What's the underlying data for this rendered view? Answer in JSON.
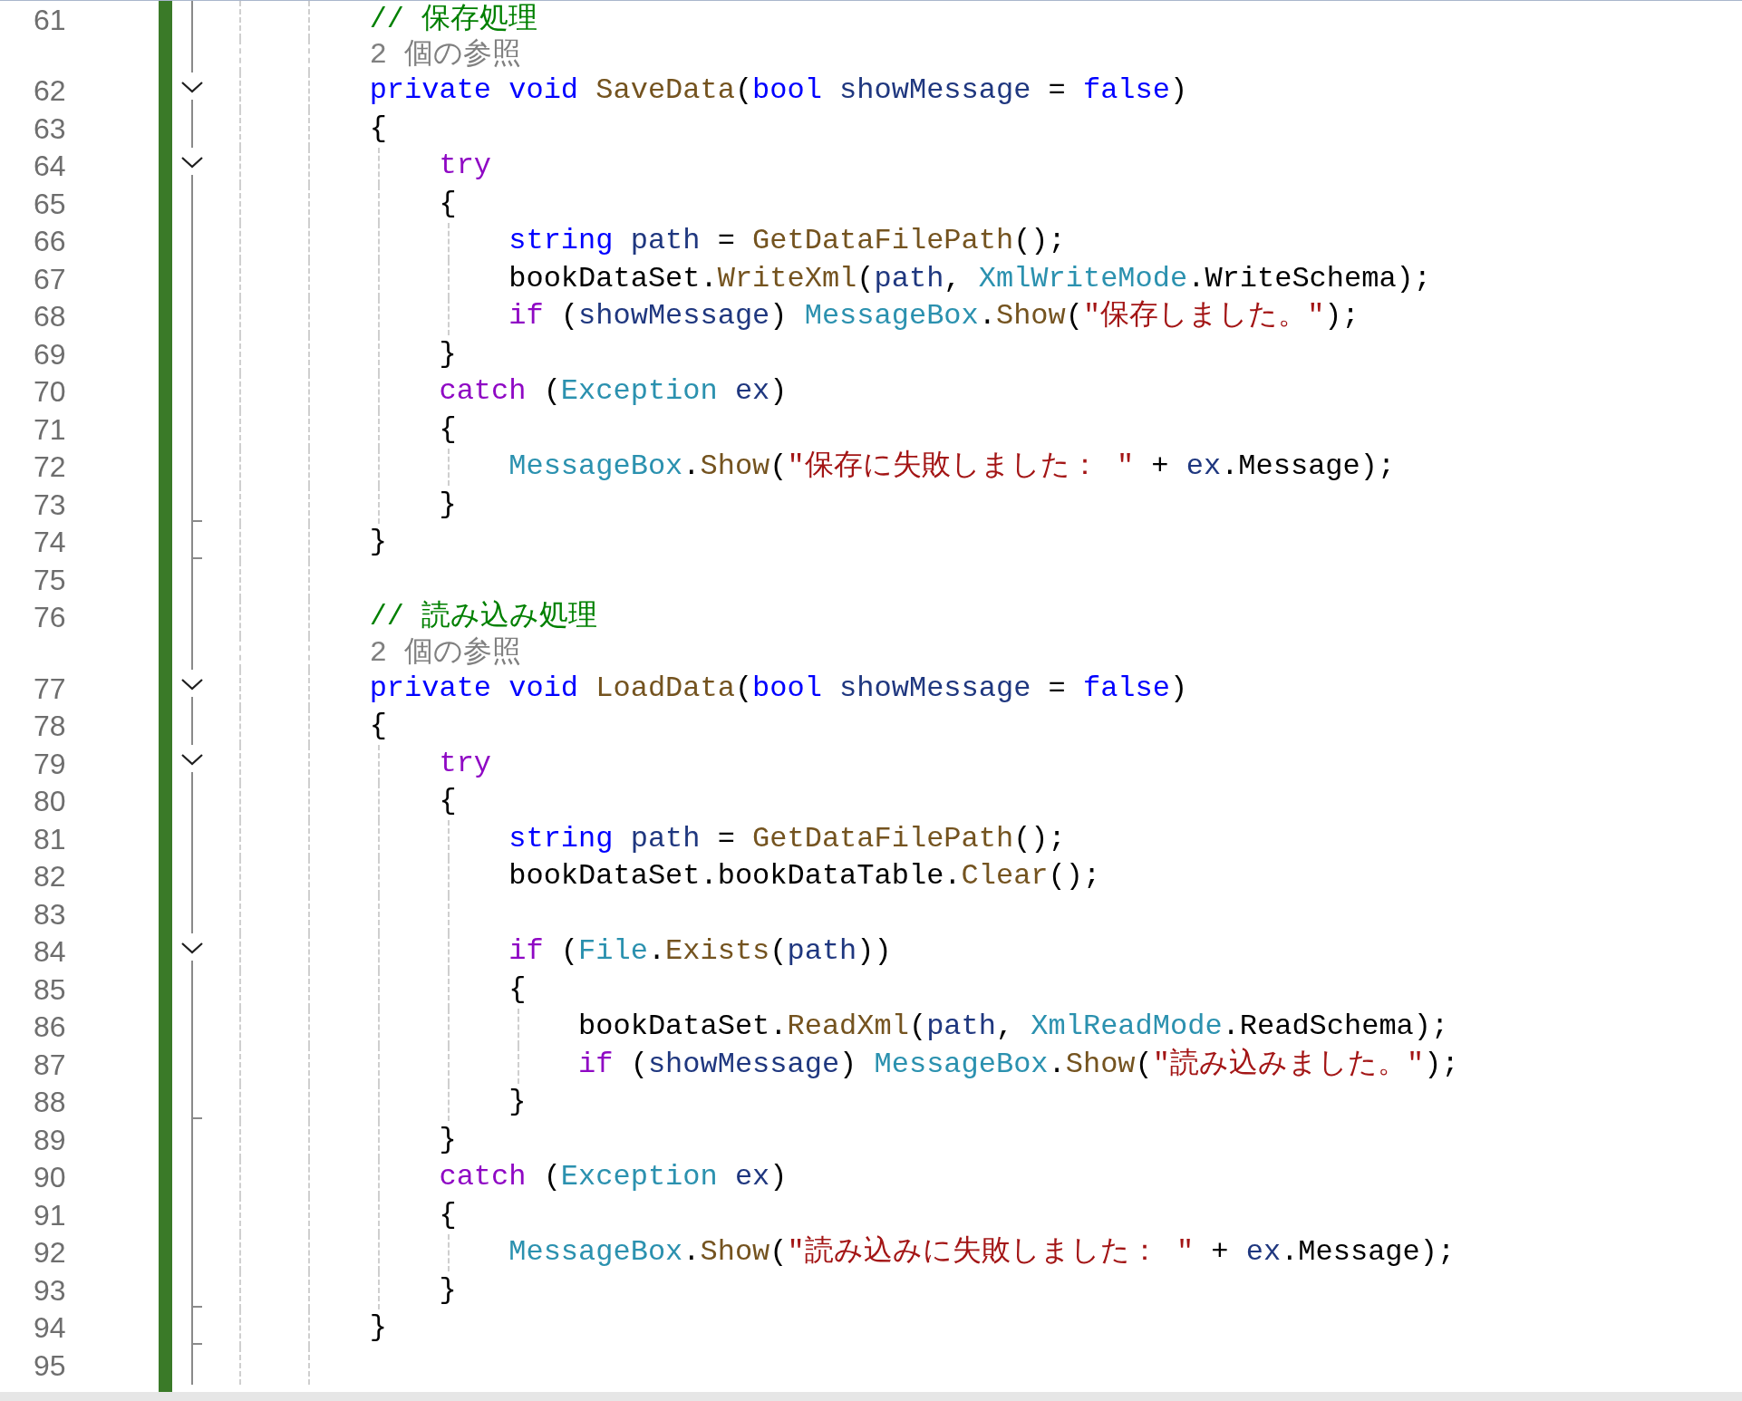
{
  "editor": {
    "lines": [
      {
        "kind": "code",
        "number": "61",
        "foldable": false,
        "block_end": false,
        "tokens": [
          {
            "kind": "comment",
            "text": "        // 保存処理"
          }
        ]
      },
      {
        "kind": "codelens",
        "foldable": false,
        "block_end": false,
        "tokens": [
          {
            "kind": "lens",
            "text": "        2 個の参照"
          }
        ]
      },
      {
        "kind": "code",
        "number": "62",
        "foldable": true,
        "block_end": false,
        "tokens": [
          {
            "kind": "keyword",
            "text": "        private "
          },
          {
            "kind": "keyword",
            "text": "void "
          },
          {
            "kind": "method",
            "text": "SaveData"
          },
          {
            "kind": "plain",
            "text": "("
          },
          {
            "kind": "keyword",
            "text": "bool "
          },
          {
            "kind": "variable",
            "text": "showMessage"
          },
          {
            "kind": "plain",
            "text": " = "
          },
          {
            "kind": "keyword",
            "text": "false"
          },
          {
            "kind": "plain",
            "text": ")"
          }
        ]
      },
      {
        "kind": "code",
        "number": "63",
        "foldable": false,
        "block_end": false,
        "tokens": [
          {
            "kind": "plain",
            "text": "        {"
          }
        ]
      },
      {
        "kind": "code",
        "number": "64",
        "foldable": true,
        "block_end": false,
        "tokens": [
          {
            "kind": "control",
            "text": "            try"
          }
        ]
      },
      {
        "kind": "code",
        "number": "65",
        "foldable": false,
        "block_end": false,
        "tokens": [
          {
            "kind": "plain",
            "text": "            {"
          }
        ]
      },
      {
        "kind": "code",
        "number": "66",
        "foldable": false,
        "block_end": false,
        "tokens": [
          {
            "kind": "keyword",
            "text": "                string "
          },
          {
            "kind": "variable",
            "text": "path"
          },
          {
            "kind": "plain",
            "text": " = "
          },
          {
            "kind": "method",
            "text": "GetDataFilePath"
          },
          {
            "kind": "plain",
            "text": "();"
          }
        ]
      },
      {
        "kind": "code",
        "number": "67",
        "foldable": false,
        "block_end": false,
        "tokens": [
          {
            "kind": "plain",
            "text": "                bookDataSet."
          },
          {
            "kind": "method",
            "text": "WriteXml"
          },
          {
            "kind": "plain",
            "text": "("
          },
          {
            "kind": "variable",
            "text": "path"
          },
          {
            "kind": "plain",
            "text": ", "
          },
          {
            "kind": "type",
            "text": "XmlWriteMode"
          },
          {
            "kind": "plain",
            "text": ".WriteSchema);"
          }
        ]
      },
      {
        "kind": "code",
        "number": "68",
        "foldable": false,
        "block_end": false,
        "tokens": [
          {
            "kind": "control",
            "text": "                if"
          },
          {
            "kind": "plain",
            "text": " ("
          },
          {
            "kind": "variable",
            "text": "showMessage"
          },
          {
            "kind": "plain",
            "text": ") "
          },
          {
            "kind": "type",
            "text": "MessageBox"
          },
          {
            "kind": "plain",
            "text": "."
          },
          {
            "kind": "method",
            "text": "Show"
          },
          {
            "kind": "plain",
            "text": "("
          },
          {
            "kind": "string",
            "text": "\"保存しました。\""
          },
          {
            "kind": "plain",
            "text": ");"
          }
        ]
      },
      {
        "kind": "code",
        "number": "69",
        "foldable": false,
        "block_end": false,
        "tokens": [
          {
            "kind": "plain",
            "text": "            }"
          }
        ]
      },
      {
        "kind": "code",
        "number": "70",
        "foldable": false,
        "block_end": false,
        "tokens": [
          {
            "kind": "control",
            "text": "            catch"
          },
          {
            "kind": "plain",
            "text": " ("
          },
          {
            "kind": "type",
            "text": "Exception "
          },
          {
            "kind": "variable",
            "text": "ex"
          },
          {
            "kind": "plain",
            "text": ")"
          }
        ]
      },
      {
        "kind": "code",
        "number": "71",
        "foldable": false,
        "block_end": false,
        "tokens": [
          {
            "kind": "plain",
            "text": "            {"
          }
        ]
      },
      {
        "kind": "code",
        "number": "72",
        "foldable": false,
        "block_end": false,
        "tokens": [
          {
            "kind": "type",
            "text": "                MessageBox"
          },
          {
            "kind": "plain",
            "text": "."
          },
          {
            "kind": "method",
            "text": "Show"
          },
          {
            "kind": "plain",
            "text": "("
          },
          {
            "kind": "string",
            "text": "\"保存に失敗しました： \""
          },
          {
            "kind": "plain",
            "text": " + "
          },
          {
            "kind": "variable",
            "text": "ex"
          },
          {
            "kind": "plain",
            "text": ".Message);"
          }
        ]
      },
      {
        "kind": "code",
        "number": "73",
        "foldable": false,
        "block_end": true,
        "tokens": [
          {
            "kind": "plain",
            "text": "            }"
          }
        ]
      },
      {
        "kind": "code",
        "number": "74",
        "foldable": false,
        "block_end": true,
        "tokens": [
          {
            "kind": "plain",
            "text": "        }"
          }
        ]
      },
      {
        "kind": "code",
        "number": "75",
        "foldable": false,
        "block_end": false
      },
      {
        "kind": "code",
        "number": "76",
        "foldable": false,
        "block_end": false,
        "tokens": [
          {
            "kind": "comment",
            "text": "        // 読み込み処理"
          }
        ]
      },
      {
        "kind": "codelens",
        "foldable": false,
        "block_end": false,
        "tokens": [
          {
            "kind": "lens",
            "text": "        2 個の参照"
          }
        ]
      },
      {
        "kind": "code",
        "number": "77",
        "foldable": true,
        "block_end": false,
        "tokens": [
          {
            "kind": "keyword",
            "text": "        private "
          },
          {
            "kind": "keyword",
            "text": "void "
          },
          {
            "kind": "method",
            "text": "LoadData"
          },
          {
            "kind": "plain",
            "text": "("
          },
          {
            "kind": "keyword",
            "text": "bool "
          },
          {
            "kind": "variable",
            "text": "showMessage"
          },
          {
            "kind": "plain",
            "text": " = "
          },
          {
            "kind": "keyword",
            "text": "false"
          },
          {
            "kind": "plain",
            "text": ")"
          }
        ]
      },
      {
        "kind": "code",
        "number": "78",
        "foldable": false,
        "block_end": false,
        "tokens": [
          {
            "kind": "plain",
            "text": "        {"
          }
        ]
      },
      {
        "kind": "code",
        "number": "79",
        "foldable": true,
        "block_end": false,
        "tokens": [
          {
            "kind": "control",
            "text": "            try"
          }
        ]
      },
      {
        "kind": "code",
        "number": "80",
        "foldable": false,
        "block_end": false,
        "tokens": [
          {
            "kind": "plain",
            "text": "            {"
          }
        ]
      },
      {
        "kind": "code",
        "number": "81",
        "foldable": false,
        "block_end": false,
        "tokens": [
          {
            "kind": "keyword",
            "text": "                string "
          },
          {
            "kind": "variable",
            "text": "path"
          },
          {
            "kind": "plain",
            "text": " = "
          },
          {
            "kind": "method",
            "text": "GetDataFilePath"
          },
          {
            "kind": "plain",
            "text": "();"
          }
        ]
      },
      {
        "kind": "code",
        "number": "82",
        "foldable": false,
        "block_end": false,
        "tokens": [
          {
            "kind": "plain",
            "text": "                bookDataSet.bookDataTable."
          },
          {
            "kind": "method",
            "text": "Clear"
          },
          {
            "kind": "plain",
            "text": "();"
          }
        ]
      },
      {
        "kind": "code",
        "number": "83",
        "foldable": false,
        "block_end": false
      },
      {
        "kind": "code",
        "number": "84",
        "foldable": true,
        "block_end": false,
        "tokens": [
          {
            "kind": "control",
            "text": "                if"
          },
          {
            "kind": "plain",
            "text": " ("
          },
          {
            "kind": "type",
            "text": "File"
          },
          {
            "kind": "plain",
            "text": "."
          },
          {
            "kind": "method",
            "text": "Exists"
          },
          {
            "kind": "plain",
            "text": "("
          },
          {
            "kind": "variable",
            "text": "path"
          },
          {
            "kind": "plain",
            "text": "))"
          }
        ]
      },
      {
        "kind": "code",
        "number": "85",
        "foldable": false,
        "block_end": false,
        "tokens": [
          {
            "kind": "plain",
            "text": "                {"
          }
        ]
      },
      {
        "kind": "code",
        "number": "86",
        "foldable": false,
        "block_end": false,
        "tokens": [
          {
            "kind": "plain",
            "text": "                    bookDataSet."
          },
          {
            "kind": "method",
            "text": "ReadXml"
          },
          {
            "kind": "plain",
            "text": "("
          },
          {
            "kind": "variable",
            "text": "path"
          },
          {
            "kind": "plain",
            "text": ", "
          },
          {
            "kind": "type",
            "text": "XmlReadMode"
          },
          {
            "kind": "plain",
            "text": ".ReadSchema);"
          }
        ]
      },
      {
        "kind": "code",
        "number": "87",
        "foldable": false,
        "block_end": false,
        "tokens": [
          {
            "kind": "control",
            "text": "                    if"
          },
          {
            "kind": "plain",
            "text": " ("
          },
          {
            "kind": "variable",
            "text": "showMessage"
          },
          {
            "kind": "plain",
            "text": ") "
          },
          {
            "kind": "type",
            "text": "MessageBox"
          },
          {
            "kind": "plain",
            "text": "."
          },
          {
            "kind": "method",
            "text": "Show"
          },
          {
            "kind": "plain",
            "text": "("
          },
          {
            "kind": "string",
            "text": "\"読み込みました。\""
          },
          {
            "kind": "plain",
            "text": ");"
          }
        ]
      },
      {
        "kind": "code",
        "number": "88",
        "foldable": false,
        "block_end": true,
        "tokens": [
          {
            "kind": "plain",
            "text": "                }"
          }
        ]
      },
      {
        "kind": "code",
        "number": "89",
        "foldable": false,
        "block_end": false,
        "tokens": [
          {
            "kind": "plain",
            "text": "            }"
          }
        ]
      },
      {
        "kind": "code",
        "number": "90",
        "foldable": false,
        "block_end": false,
        "tokens": [
          {
            "kind": "control",
            "text": "            catch"
          },
          {
            "kind": "plain",
            "text": " ("
          },
          {
            "kind": "type",
            "text": "Exception "
          },
          {
            "kind": "variable",
            "text": "ex"
          },
          {
            "kind": "plain",
            "text": ")"
          }
        ]
      },
      {
        "kind": "code",
        "number": "91",
        "foldable": false,
        "block_end": false,
        "tokens": [
          {
            "kind": "plain",
            "text": "            {"
          }
        ]
      },
      {
        "kind": "code",
        "number": "92",
        "foldable": false,
        "block_end": false,
        "tokens": [
          {
            "kind": "type",
            "text": "                MessageBox"
          },
          {
            "kind": "plain",
            "text": "."
          },
          {
            "kind": "method",
            "text": "Show"
          },
          {
            "kind": "plain",
            "text": "("
          },
          {
            "kind": "string",
            "text": "\"読み込みに失敗しました： \""
          },
          {
            "kind": "plain",
            "text": " + "
          },
          {
            "kind": "variable",
            "text": "ex"
          },
          {
            "kind": "plain",
            "text": ".Message);"
          }
        ]
      },
      {
        "kind": "code",
        "number": "93",
        "foldable": false,
        "block_end": true,
        "tokens": [
          {
            "kind": "plain",
            "text": "            }"
          }
        ]
      },
      {
        "kind": "code",
        "number": "94",
        "foldable": false,
        "block_end": true,
        "tokens": [
          {
            "kind": "plain",
            "text": "        }"
          }
        ]
      },
      {
        "kind": "code",
        "number": "95",
        "foldable": false,
        "block_end": false
      }
    ]
  }
}
